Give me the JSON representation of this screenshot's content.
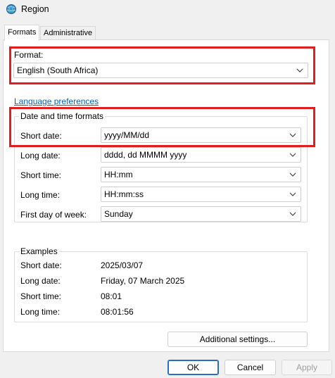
{
  "window": {
    "title": "Region"
  },
  "tabs": [
    {
      "label": "Formats",
      "active": true
    },
    {
      "label": "Administrative",
      "active": false
    }
  ],
  "format": {
    "label": "Format:",
    "value": "English (South Africa)"
  },
  "language_link": "Language preferences",
  "datetime": {
    "group_title": "Date and time formats",
    "fields": [
      {
        "label": "Short date:",
        "value": "yyyy/MM/dd"
      },
      {
        "label": "Long date:",
        "value": "dddd, dd MMMM yyyy"
      },
      {
        "label": "Short time:",
        "value": "HH:mm"
      },
      {
        "label": "Long time:",
        "value": "HH:mm:ss"
      },
      {
        "label": "First day of week:",
        "value": "Sunday"
      }
    ]
  },
  "examples": {
    "group_title": "Examples",
    "rows": [
      {
        "label": "Short date:",
        "value": "2025/03/07"
      },
      {
        "label": "Long date:",
        "value": "Friday, 07 March 2025"
      },
      {
        "label": "Short time:",
        "value": "08:01"
      },
      {
        "label": "Long time:",
        "value": "08:01:56"
      }
    ]
  },
  "buttons": {
    "additional": "Additional settings...",
    "ok": "OK",
    "cancel": "Cancel",
    "apply": "Apply"
  },
  "colors": {
    "highlight_red": "#e01e1e",
    "link_blue": "#0a5fc7",
    "primary_border": "#2b6cc5"
  }
}
